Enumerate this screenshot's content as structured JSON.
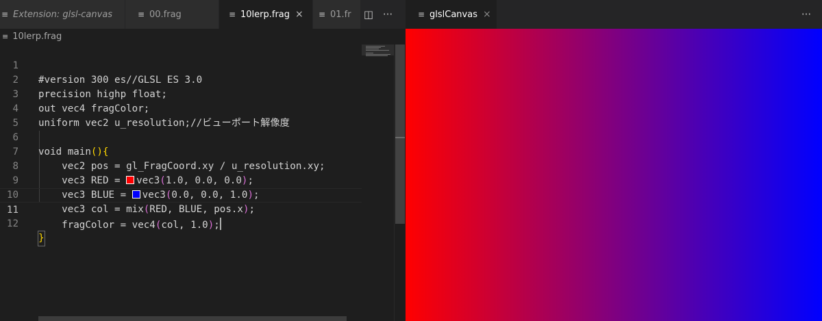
{
  "left_group": {
    "tabs": [
      {
        "label": "Extension: glsl-canvas",
        "icon": "extension-icon"
      },
      {
        "label": "00.frag",
        "icon": "file-lines-icon"
      },
      {
        "label": "10lerp.frag",
        "icon": "file-lines-icon",
        "active": true,
        "close": "×"
      },
      {
        "label": "01.fr",
        "icon": "file-lines-icon"
      }
    ],
    "actions": {
      "split": "◫",
      "more": "···"
    },
    "breadcrumb": {
      "file": "10lerp.frag"
    }
  },
  "editor": {
    "lines": [
      {
        "n": "1",
        "text": "#version 300 es//GLSL ES 3.0"
      },
      {
        "n": "2",
        "text": "precision highp float;"
      },
      {
        "n": "3",
        "text": "out vec4 fragColor;"
      },
      {
        "n": "4",
        "text": "uniform vec2 u_resolution;//ビューポート解像度"
      },
      {
        "n": "5",
        "text": ""
      },
      {
        "n": "6",
        "a": "void main",
        "b": "(",
        "c": ")",
        "d": "{"
      },
      {
        "n": "7",
        "text": "    vec2 pos = gl_FragCoord.xy / u_resolution.xy;"
      },
      {
        "n": "8",
        "a": "    vec3 RED = ",
        "b": "vec3",
        "c": "(",
        "d": "1.0, 0.0, 0.0",
        "e": ")",
        "f": ";"
      },
      {
        "n": "9",
        "a": "    vec3 BLUE = ",
        "b": "vec3",
        "c": "(",
        "d": "0.0, 0.0, 1.0",
        "e": ")",
        "f": ";"
      },
      {
        "n": "10",
        "a": "    vec3 col = mix",
        "b": "(",
        "c": "RED, BLUE, pos.x",
        "d": ")",
        "e": ";"
      },
      {
        "n": "11",
        "a": "    fragColor = vec4",
        "b": "(",
        "c": "col, 1.0",
        "d": ")",
        "e": ";"
      },
      {
        "n": "12",
        "text": "}"
      }
    ],
    "current_line": "11"
  },
  "right_group": {
    "tab": {
      "label": "glslCanvas",
      "icon": "file-lines-icon",
      "close": "×"
    },
    "more": "···"
  },
  "colors": {
    "red_swatch": "#ff0000",
    "blue_swatch": "#0000ff",
    "gradient_start": "#ff0000",
    "gradient_end": "#0000ff",
    "bracket_level1": "#ffd700",
    "bracket_level2": "#da70d6"
  }
}
